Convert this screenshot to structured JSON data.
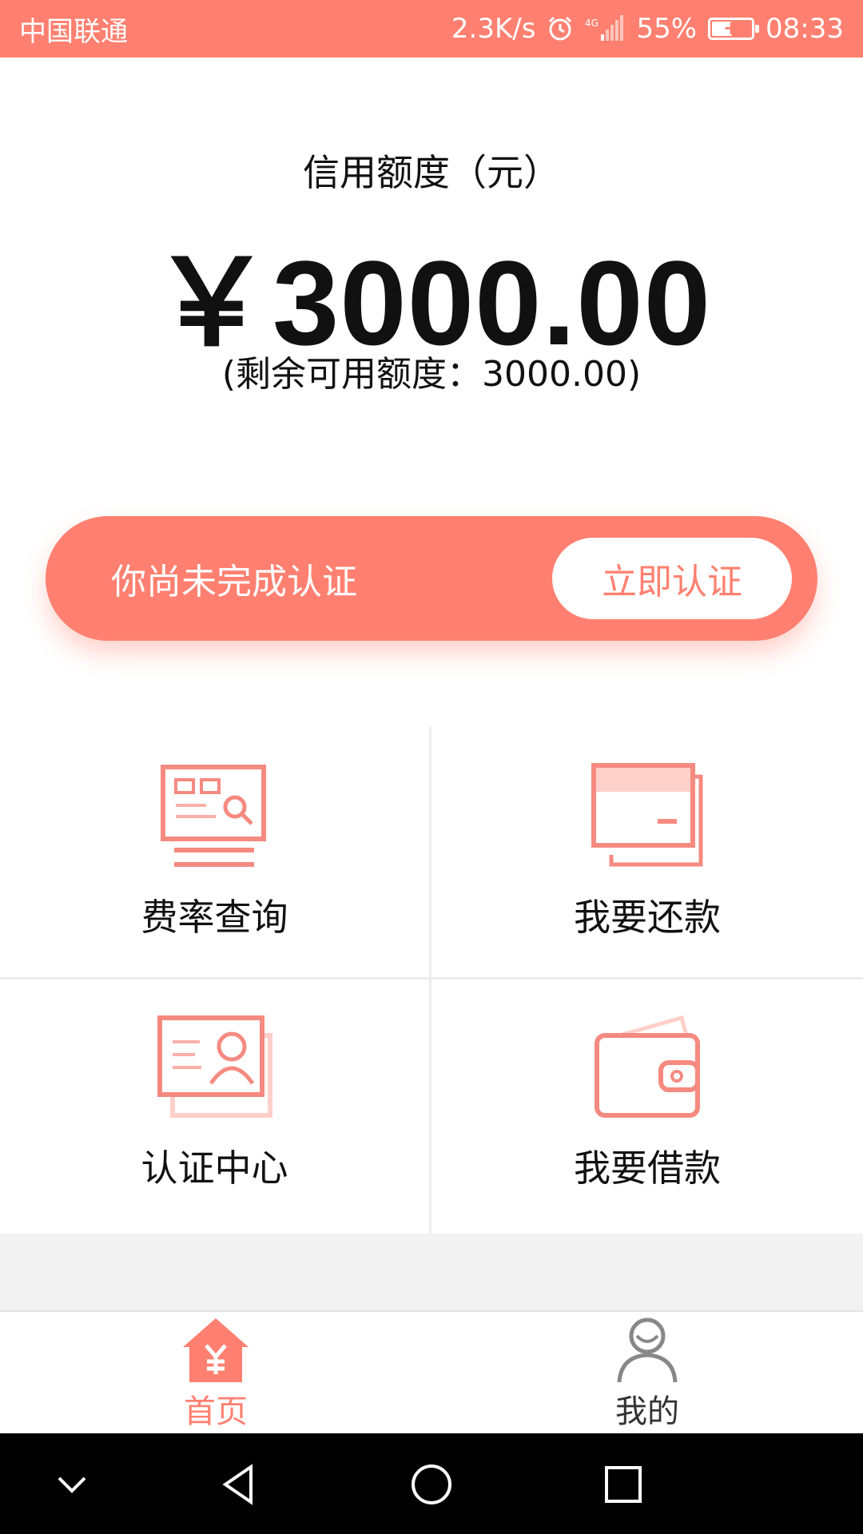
{
  "status_bar": {
    "carrier": "中国联通",
    "net_speed": "2.3K/s",
    "network": "4G",
    "battery_pct": "55%",
    "battery_level": 0.55,
    "time": "08:33",
    "bg_color": "#ff8070"
  },
  "credit": {
    "title": "信用额度（元）",
    "amount": "￥3000.00",
    "remaining": "(剩余可用额度：3000.00)"
  },
  "verify_banner": {
    "message": "你尚未完成认证",
    "button_label": "立即认证"
  },
  "grid": {
    "items": [
      {
        "label": "费率查询",
        "icon": "rate-query-icon"
      },
      {
        "label": "我要还款",
        "icon": "card-repay-icon"
      },
      {
        "label": "认证中心",
        "icon": "id-card-icon"
      },
      {
        "label": "我要借款",
        "icon": "wallet-icon"
      }
    ]
  },
  "bottom_nav": {
    "items": [
      {
        "label": "首页",
        "icon": "home-yen-icon",
        "active": true
      },
      {
        "label": "我的",
        "icon": "user-icon",
        "active": false
      }
    ]
  },
  "system_nav": {
    "icons": [
      "chevron-down-icon",
      "back-icon",
      "home-icon",
      "recents-icon"
    ]
  },
  "colors": {
    "accent": "#ff8070",
    "accent_light": "#ffd4cf"
  }
}
